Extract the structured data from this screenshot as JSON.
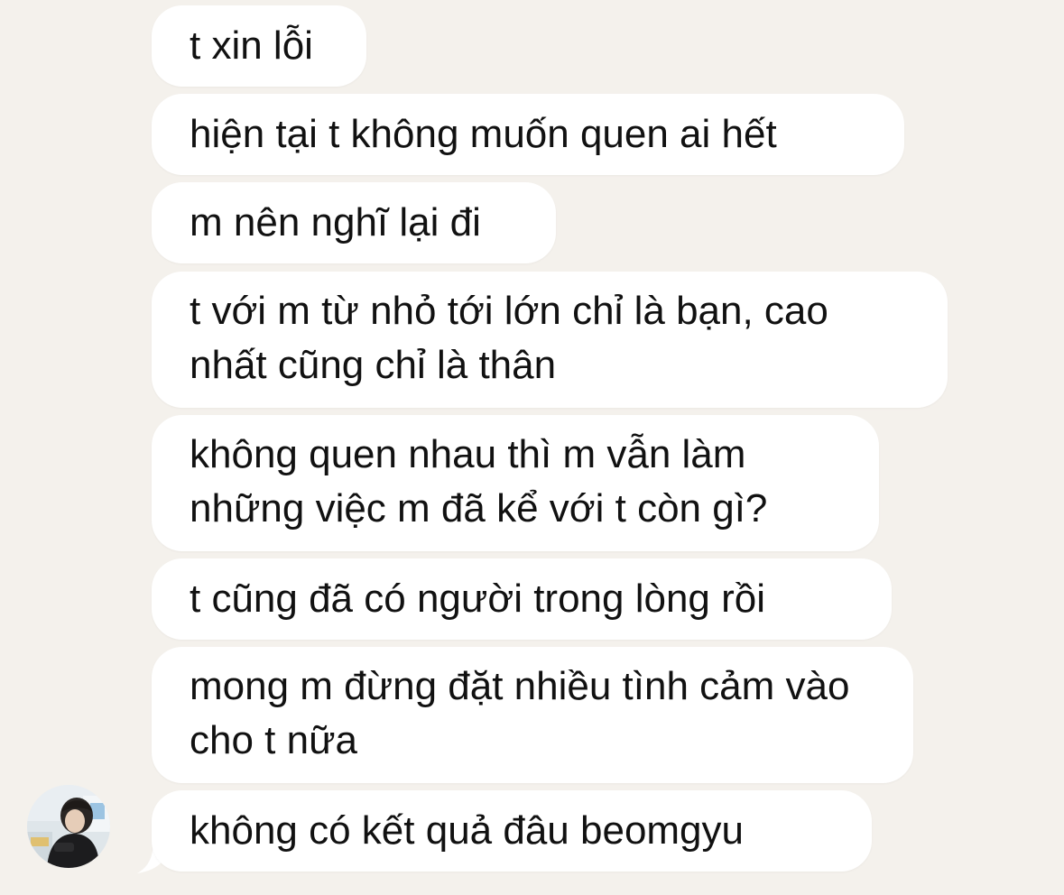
{
  "conversation": {
    "messages": [
      {
        "text": "t xin lỗi"
      },
      {
        "text": "hiện tại t không muốn quen ai hết"
      },
      {
        "text": "m nên nghĩ lại đi"
      },
      {
        "text": "t với m từ nhỏ tới lớn chỉ là bạn, cao nhất cũng chỉ là thân"
      },
      {
        "text": "không quen nhau thì m vẫn làm những việc m đã kể với t còn gì?"
      },
      {
        "text": "t cũng đã có người trong lòng rồi"
      },
      {
        "text": "mong m đừng đặt nhiều tình cảm vào cho t nữa"
      },
      {
        "text": "không có kết quả đâu beomgyu"
      }
    ]
  },
  "colors": {
    "background": "#f4f1ec",
    "bubble": "#ffffff",
    "text": "#111111"
  }
}
